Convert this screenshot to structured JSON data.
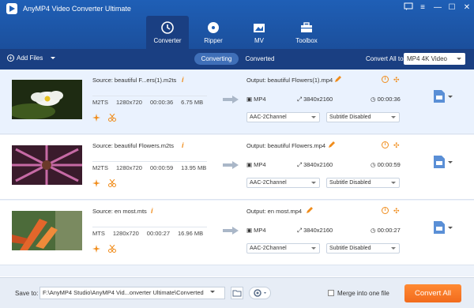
{
  "app": {
    "title": "AnyMP4 Video Converter Ultimate"
  },
  "nav": {
    "tabs": [
      {
        "label": "Converter",
        "icon": "converter-icon",
        "active": true
      },
      {
        "label": "Ripper",
        "icon": "disc-icon",
        "active": false
      },
      {
        "label": "MV",
        "icon": "mv-icon",
        "active": false
      },
      {
        "label": "Toolbox",
        "icon": "toolbox-icon",
        "active": false
      }
    ]
  },
  "toolbar": {
    "add_files": "Add Files",
    "tab_converting": "Converting",
    "tab_converted": "Converted",
    "convert_all_label": "Convert All to:",
    "convert_all_value": "MP4 4K Video"
  },
  "files": [
    {
      "source": "Source: beautiful F...ers(1).m2ts",
      "format": "M2TS",
      "resolution": "1280x720",
      "duration": "00:00:36",
      "size": "6.75 MB",
      "output": "Output: beautiful Flowers(1).mp4",
      "out_format": "MP4",
      "out_resolution": "3840x2160",
      "out_duration": "00:00:36",
      "audio": "AAC-2Channel",
      "subtitle": "Subtitle Disabled"
    },
    {
      "source": "Source: beautiful Flowers.m2ts",
      "format": "M2TS",
      "resolution": "1280x720",
      "duration": "00:00:59",
      "size": "13.95 MB",
      "output": "Output: beautiful Flowers.mp4",
      "out_format": "MP4",
      "out_resolution": "3840x2160",
      "out_duration": "00:00:59",
      "audio": "AAC-2Channel",
      "subtitle": "Subtitle Disabled"
    },
    {
      "source": "Source: en most.mts",
      "format": "MTS",
      "resolution": "1280x720",
      "duration": "00:00:27",
      "size": "16.96 MB",
      "output": "Output: en most.mp4",
      "out_format": "MP4",
      "out_resolution": "3840x2160",
      "out_duration": "00:00:27",
      "audio": "AAC-2Channel",
      "subtitle": "Subtitle Disabled"
    }
  ],
  "footer": {
    "save_to_label": "Save to:",
    "save_path": "F:\\AnyMP4 Studio\\AnyMP4 Vid...onverter Ultimate\\Converted",
    "merge_label": "Merge into one file",
    "convert_all_button": "Convert All"
  }
}
